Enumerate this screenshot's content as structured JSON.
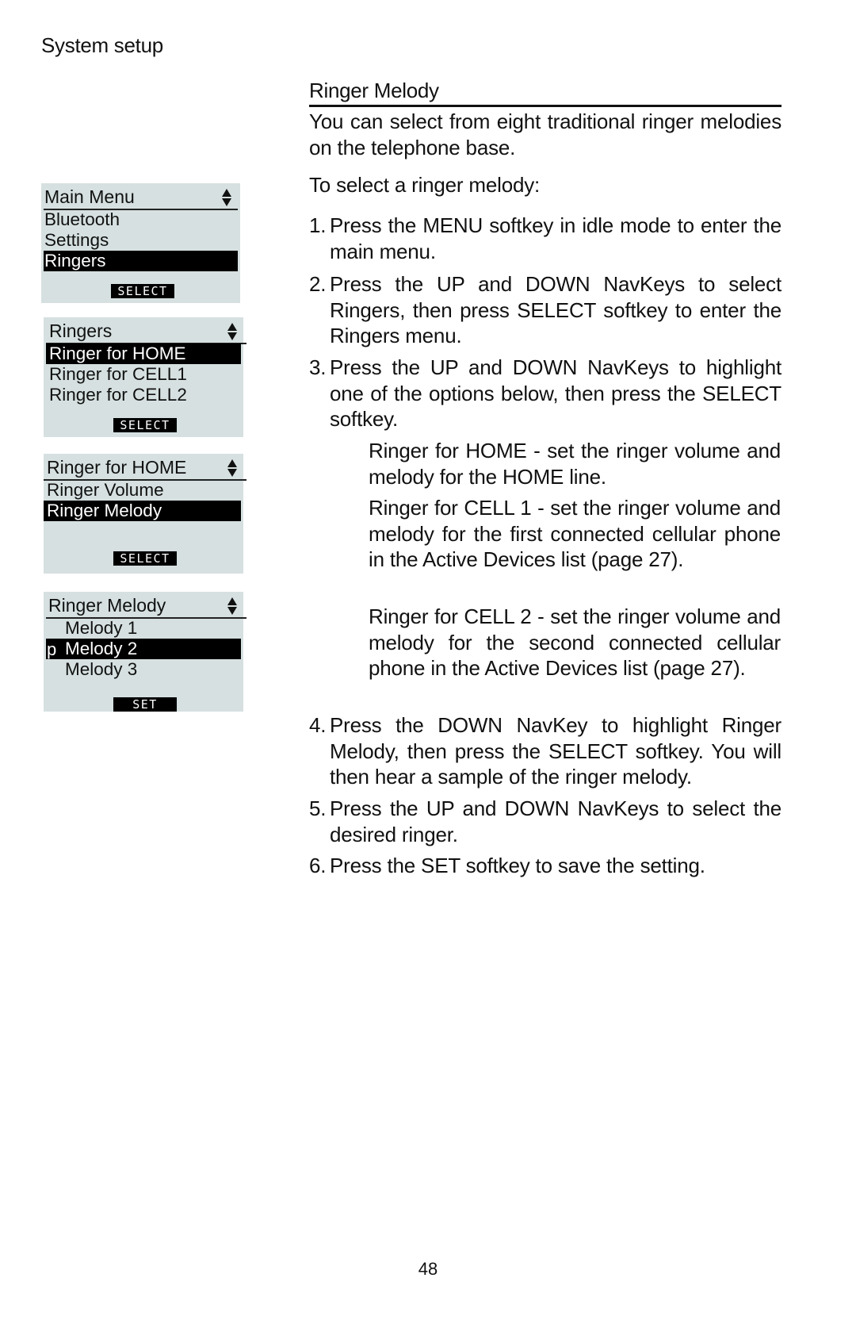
{
  "page": {
    "section_label": "System setup",
    "page_number": "48"
  },
  "screens": [
    {
      "title": "Main Menu",
      "scroll_icon": "up-down-arrow-icon",
      "items": [
        {
          "label": "Bluetooth",
          "highlighted": false
        },
        {
          "label": "Settings",
          "highlighted": false
        },
        {
          "label": "Ringers",
          "highlighted": true
        }
      ],
      "softkey": "SELECT"
    },
    {
      "title": "Ringers",
      "scroll_icon": "up-down-arrow-icon",
      "items": [
        {
          "label": "Ringer for HOME",
          "highlighted": true
        },
        {
          "label": "Ringer for CELL1",
          "highlighted": false
        },
        {
          "label": "Ringer for CELL2",
          "highlighted": false
        }
      ],
      "softkey": "SELECT"
    },
    {
      "title": "Ringer for HOME",
      "scroll_icon": "up-down-arrow-icon",
      "items": [
        {
          "label": "Ringer Volume",
          "highlighted": false
        },
        {
          "label": "Ringer Melody",
          "highlighted": true
        }
      ],
      "softkey": "SELECT"
    },
    {
      "title": "Ringer Melody",
      "scroll_icon": "up-down-arrow-icon",
      "items": [
        {
          "label": "Melody 1",
          "highlighted": false,
          "marker": ""
        },
        {
          "label": "Melody 2",
          "highlighted": true,
          "marker": "p"
        },
        {
          "label": "Melody 3",
          "highlighted": false,
          "marker": ""
        }
      ],
      "softkey": "SET"
    }
  ],
  "content": {
    "heading": "Ringer Melody",
    "intro": "You can select from eight traditional ringer melodies on the telephone base.",
    "lead": "To select a ringer melody:",
    "steps": [
      {
        "num": "1.",
        "text": "Press the MENU softkey in idle mode to enter the main menu."
      },
      {
        "num": "2.",
        "text": "Press the UP and DOWN NavKeys to select Ringers, then press SELECT softkey to enter the Ringers menu."
      },
      {
        "num": "3.",
        "text": "Press the UP and DOWN NavKeys to highlight one of the options below, then press the SELECT softkey."
      },
      {
        "num": "4.",
        "text": "Press the DOWN NavKey to highlight Ringer Melody, then press the SELECT softkey. You will then hear a sample of the ringer melody."
      },
      {
        "num": "5.",
        "text": "Press the UP and DOWN NavKeys to select the desired ringer."
      },
      {
        "num": "6.",
        "text": "Press the SET softkey to save the setting."
      }
    ],
    "options": [
      {
        "text": "Ringer for HOME - set the ringer volume and melody for the HOME line."
      },
      {
        "text": "Ringer for CELL 1 - set the ringer volume and melody for the first connected cellular phone in the Active Devices list (page 27)."
      },
      {
        "text": "Ringer for CELL 2 - set the ringer volume and melody for the second connected cellular phone in the Active Devices list (page 27)."
      }
    ]
  }
}
